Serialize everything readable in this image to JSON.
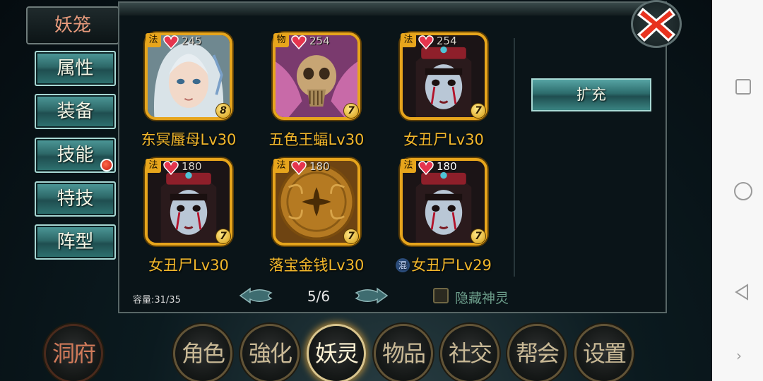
{
  "left_panel": {
    "cage_tab": "妖笼",
    "menu": [
      {
        "id": "attributes",
        "label": "属性"
      },
      {
        "id": "equipment",
        "label": "装备"
      },
      {
        "id": "skills",
        "label": "技能"
      },
      {
        "id": "special",
        "label": "特技"
      },
      {
        "id": "formation",
        "label": "阵型"
      }
    ]
  },
  "cards": [
    {
      "type": "法",
      "hp": "245",
      "level": "8",
      "name": "东冥蜃母Lv30",
      "portrait": "white-haired-lady-portrait"
    },
    {
      "type": "物",
      "hp": "254",
      "level": "7",
      "name": "五色王蝠Lv30",
      "portrait": "bat-skull-portrait"
    },
    {
      "type": "法",
      "hp": "254",
      "level": "7",
      "name": "女丑尸Lv30",
      "portrait": "pale-girl-portrait"
    },
    {
      "type": "法",
      "hp": "180",
      "level": "7",
      "name": "女丑尸Lv30",
      "portrait": "pale-girl-portrait"
    },
    {
      "type": "法",
      "hp": "180",
      "level": "7",
      "name": "落宝金钱Lv30",
      "portrait": "golden-coin-portrait"
    },
    {
      "type": "法",
      "hp": "180",
      "level": "7",
      "name": "女丑尸Lv29",
      "portrait": "pale-girl-portrait",
      "prefix_badge": "混"
    }
  ],
  "expand_button": "扩充",
  "capacity": "容量:31/35",
  "page_indicator": "5/6",
  "hide_spirits_label": "隐藏神灵",
  "dock": [
    {
      "id": "cave",
      "label": "洞府"
    },
    {
      "id": "character",
      "label": "角色"
    },
    {
      "id": "enhance",
      "label": "強化"
    },
    {
      "id": "spirit",
      "label": "妖灵"
    },
    {
      "id": "items",
      "label": "物品"
    },
    {
      "id": "social",
      "label": "社交"
    },
    {
      "id": "guild",
      "label": "帮会"
    },
    {
      "id": "settings",
      "label": "设置"
    }
  ],
  "colors": {
    "gold": "#e7a51c",
    "name_gold": "#f2b72b",
    "teal": "#2d6868",
    "close_red": "#e8321e"
  }
}
